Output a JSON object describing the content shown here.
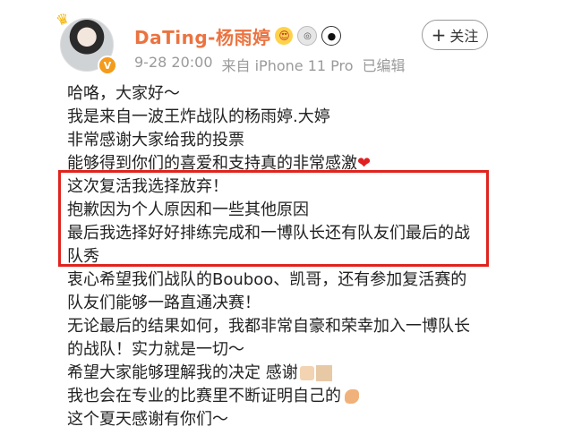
{
  "header": {
    "username": "DaTing-杨雨婷",
    "badges": [
      "love-face-badge",
      "medal-badge",
      "panda-badge"
    ],
    "verified_badge": "V",
    "timestamp": "9-28 20:00",
    "source": "来自 iPhone 11 Pro",
    "edited": "已编辑",
    "follow_label": "关注",
    "follow_icon": "+"
  },
  "post": {
    "lines": [
      "哈咯，大家好～",
      "我是来自一波王炸战队的杨雨婷.大婷",
      "非常感谢大家给我的投票",
      "能够得到你们的喜爱和支持真的非常感激",
      "这次复活我选择放弃！",
      "抱歉因为个人原因和一些其他原因",
      "最后我选择好好排练完成和一博队长还有队友们最后的战",
      "队秀",
      "衷心希望我们战队的Bouboo、凯哥，还有参加复活赛的",
      "队友们能够一路直通决赛！",
      "无论最后的结果如何，我都非常自豪和荣幸加入一博队长",
      "的战队！实力就是一切～",
      "希望大家能够理解我的决定 感谢",
      "我也会在专业的比赛里不断证明自己的",
      "这个夏天感谢有你们～"
    ],
    "heart": "❤"
  },
  "colors": {
    "username": "#eb7340",
    "highlight_border": "#e0241e",
    "meta_text": "#9a9a9a"
  }
}
